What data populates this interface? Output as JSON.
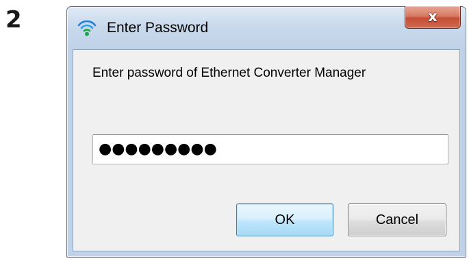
{
  "step": {
    "number": "2"
  },
  "dialog": {
    "title": "Enter Password",
    "title_icon": "wireless-signal-icon",
    "close_label": "x",
    "prompt": "Enter password of Ethernet Converter Manager",
    "password": {
      "masked_value": "●●●●●●●●●"
    },
    "buttons": {
      "ok_label": "OK",
      "cancel_label": "Cancel"
    }
  },
  "colors": {
    "frame": "#c8d9ec",
    "client": "#f0f0f0",
    "close_button": "#c44d35",
    "ok_border": "#3c7fb1",
    "icon_green": "#1aa64b",
    "icon_blue": "#1e7fd9"
  }
}
